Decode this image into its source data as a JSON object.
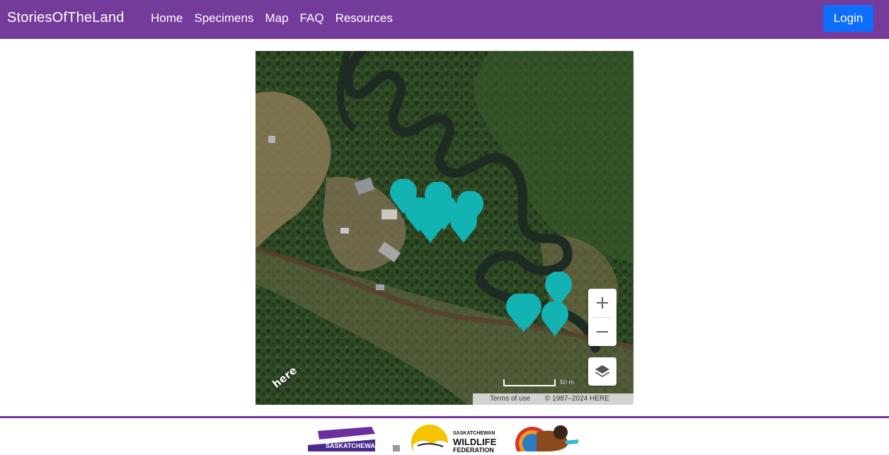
{
  "navbar": {
    "brand": "StoriesOfTheLand",
    "links": [
      "Home",
      "Specimens",
      "Map",
      "FAQ",
      "Resources"
    ],
    "login_label": "Login",
    "bg_color": "#753b9b",
    "login_color": "#0d6efd"
  },
  "map": {
    "marker_color": "#14b3b3",
    "marker_count": 12,
    "zoom_in": "+",
    "zoom_out": "−",
    "scale_label": "50 m",
    "terms": "Terms of use",
    "copyright": "© 1987–2024 HERE",
    "provider_logo": "here"
  },
  "footer": {
    "sk_logo_text": "SASKATCHEWAN",
    "swf_small": "SASKATCHEWAN",
    "swf_big": "WILDLIFE",
    "swf_fed": "FEDERATION",
    "line_color": "#753b9b"
  }
}
